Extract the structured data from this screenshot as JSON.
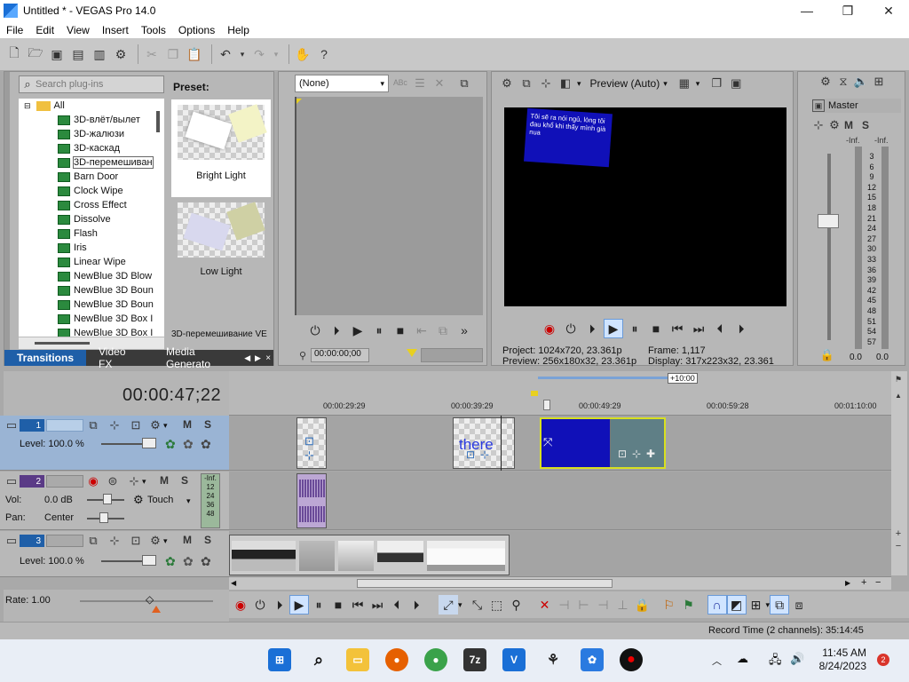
{
  "window": {
    "title": "Untitled * - VEGAS Pro 14.0",
    "min": "—",
    "max": "❐",
    "close": "✕"
  },
  "menu": [
    "File",
    "Edit",
    "View",
    "Insert",
    "Tools",
    "Options",
    "Help"
  ],
  "transitions": {
    "search_placeholder": "Search plug-ins",
    "preset_label": "Preset:",
    "root": "All",
    "items": [
      "3D-влёт/вылет",
      "3D-жалюзи",
      "3D-каскад",
      "3D-перемешиван",
      "Barn Door",
      "Clock Wipe",
      "Cross Effect",
      "Dissolve",
      "Flash",
      "Iris",
      "Linear Wipe",
      "NewBlue  3D Blow",
      "NewBlue  3D Boun",
      "NewBlue  3D Boun",
      "NewBlue  3D Box I",
      "NewBlue  3D Box I"
    ],
    "selected_index": 3,
    "presets": [
      "Bright Light",
      "Low Light"
    ],
    "status": "3D-перемешивание VE",
    "tabs": [
      "Transitions",
      "Video FX",
      "Media Generato"
    ]
  },
  "trimmer": {
    "dropdown": "(None)",
    "timecode": "00:00:00;00"
  },
  "preview": {
    "mode": "Preview (Auto)",
    "overlay_text": "Tôi sẽ ra nói ngủ, lòng tôi đau khổ khi thấy mình già nua",
    "project_label": "Project:",
    "project": "1024x720, 23.361p",
    "frame_label": "Frame:",
    "frame": "1,117",
    "preview_label": "Preview:",
    "preview": "256x180x32, 23.361p",
    "display_label": "Display:",
    "display": "317x223x32, 23.361"
  },
  "master": {
    "label": "Master",
    "m": "M",
    "s": "S",
    "inf_left": "-Inf.",
    "inf_right": "-Inf.",
    "scale": [
      "3",
      "6",
      "9",
      "12",
      "15",
      "18",
      "21",
      "24",
      "27",
      "30",
      "33",
      "36",
      "39",
      "42",
      "45",
      "48",
      "51",
      "54",
      "57"
    ],
    "val_left": "0.0",
    "val_right": "0.0"
  },
  "timeline": {
    "timecode": "00:00:47;22",
    "marker": "+10:00",
    "ruler": [
      "00:00:29:29",
      "00:00:39:29",
      "00:00:49:29",
      "00:00:59:28",
      "00:01:10:00"
    ],
    "clip_text": "there"
  },
  "tracks": [
    {
      "num": "1",
      "level_label": "Level:",
      "level": "100.0 %",
      "m": "M",
      "s": "S"
    },
    {
      "num": "2",
      "vol_label": "Vol:",
      "vol": "0.0 dB",
      "pan_label": "Pan:",
      "pan": "Center",
      "touch": "Touch",
      "m": "M",
      "s": "S",
      "meter_top": "-Inf.",
      "meter": [
        "12",
        "24",
        "36",
        "48"
      ]
    },
    {
      "num": "3",
      "level_label": "Level:",
      "level": "100.0 %",
      "m": "M",
      "s": "S"
    }
  ],
  "transport": {
    "rate": "Rate: 1.00"
  },
  "status": {
    "record_time": "Record Time (2 channels): 35:14:45"
  },
  "taskbar": {
    "time": "11:45 AM",
    "date": "8/24/2023",
    "badge": "2",
    "sevenzip": "7z"
  },
  "colors": {
    "accent": "#1f5fa8",
    "selection_track": "#9ab4d4",
    "clip_blue": "#1010b8",
    "playhead_yellow": "#e8d020"
  }
}
